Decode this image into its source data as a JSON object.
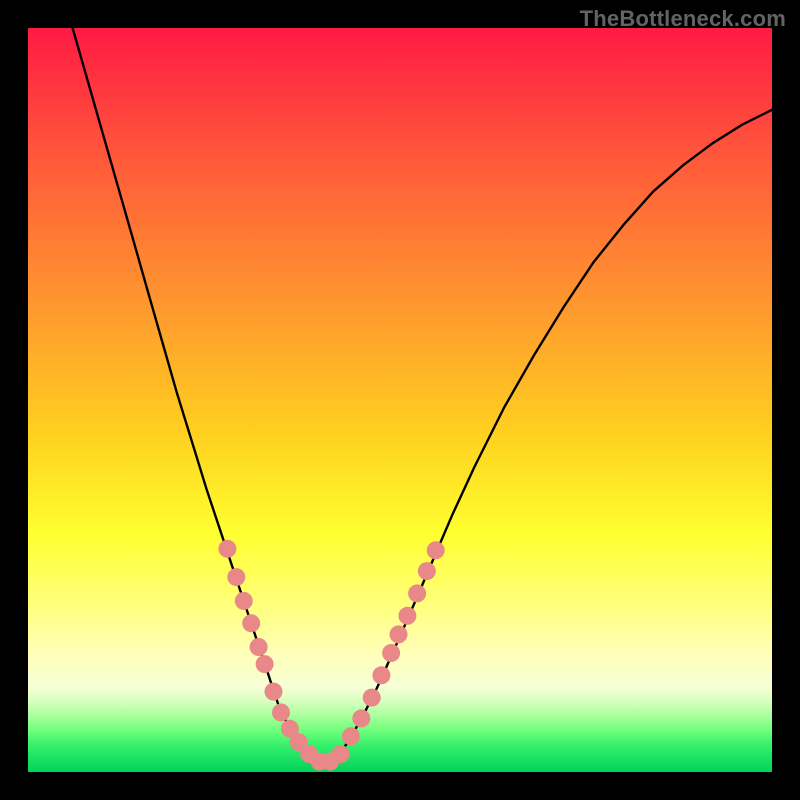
{
  "watermark": "TheBottleneck.com",
  "chart_data": {
    "type": "line",
    "title": "",
    "xlabel": "",
    "ylabel": "",
    "xlim": [
      0,
      1
    ],
    "ylim": [
      0,
      1
    ],
    "note": "Axes unlabeled in source image; x and y normalized 0–1. Primary curve is a V-shaped bottleneck profile plotted over a vertical rainbow heat gradient (red→orange→yellow→green). Reddish dot markers cluster around the trough of the curve.",
    "gradient_stops": [
      {
        "offset": 0.0,
        "color": "#ff1a44"
      },
      {
        "offset": 0.18,
        "color": "#ff5a3a"
      },
      {
        "offset": 0.38,
        "color": "#ff9a2e"
      },
      {
        "offset": 0.55,
        "color": "#ffd21f"
      },
      {
        "offset": 0.68,
        "color": "#ffff30"
      },
      {
        "offset": 0.78,
        "color": "#ffff80"
      },
      {
        "offset": 0.84,
        "color": "#ffffb8"
      },
      {
        "offset": 0.885,
        "color": "#f6ffd6"
      },
      {
        "offset": 0.905,
        "color": "#d8ffbe"
      },
      {
        "offset": 0.925,
        "color": "#a8ff9c"
      },
      {
        "offset": 0.945,
        "color": "#6cff7a"
      },
      {
        "offset": 0.965,
        "color": "#34f06a"
      },
      {
        "offset": 1.0,
        "color": "#00d25a"
      }
    ],
    "series": [
      {
        "name": "bottleneck-curve",
        "x": [
          0.06,
          0.08,
          0.1,
          0.12,
          0.14,
          0.16,
          0.18,
          0.2,
          0.22,
          0.24,
          0.26,
          0.28,
          0.3,
          0.31,
          0.32,
          0.33,
          0.34,
          0.355,
          0.37,
          0.385,
          0.4,
          0.415,
          0.43,
          0.45,
          0.47,
          0.49,
          0.51,
          0.54,
          0.57,
          0.6,
          0.64,
          0.68,
          0.72,
          0.76,
          0.8,
          0.84,
          0.88,
          0.92,
          0.96,
          1.0
        ],
        "y": [
          1.0,
          0.93,
          0.86,
          0.79,
          0.72,
          0.65,
          0.58,
          0.51,
          0.445,
          0.38,
          0.32,
          0.26,
          0.2,
          0.17,
          0.14,
          0.11,
          0.08,
          0.055,
          0.035,
          0.02,
          0.012,
          0.02,
          0.04,
          0.075,
          0.115,
          0.16,
          0.205,
          0.275,
          0.345,
          0.41,
          0.49,
          0.56,
          0.625,
          0.685,
          0.735,
          0.78,
          0.815,
          0.845,
          0.87,
          0.89
        ]
      }
    ],
    "scatter": {
      "name": "trough-dots",
      "color": "#e98888",
      "points": [
        {
          "x": 0.268,
          "y": 0.3
        },
        {
          "x": 0.28,
          "y": 0.262
        },
        {
          "x": 0.29,
          "y": 0.23
        },
        {
          "x": 0.3,
          "y": 0.2
        },
        {
          "x": 0.31,
          "y": 0.168
        },
        {
          "x": 0.318,
          "y": 0.145
        },
        {
          "x": 0.33,
          "y": 0.108
        },
        {
          "x": 0.34,
          "y": 0.08
        },
        {
          "x": 0.352,
          "y": 0.058
        },
        {
          "x": 0.364,
          "y": 0.04
        },
        {
          "x": 0.378,
          "y": 0.024
        },
        {
          "x": 0.392,
          "y": 0.014
        },
        {
          "x": 0.406,
          "y": 0.014
        },
        {
          "x": 0.42,
          "y": 0.024
        },
        {
          "x": 0.434,
          "y": 0.048
        },
        {
          "x": 0.448,
          "y": 0.072
        },
        {
          "x": 0.462,
          "y": 0.1
        },
        {
          "x": 0.475,
          "y": 0.13
        },
        {
          "x": 0.488,
          "y": 0.16
        },
        {
          "x": 0.498,
          "y": 0.185
        },
        {
          "x": 0.51,
          "y": 0.21
        },
        {
          "x": 0.523,
          "y": 0.24
        },
        {
          "x": 0.536,
          "y": 0.27
        },
        {
          "x": 0.548,
          "y": 0.298
        }
      ]
    }
  }
}
